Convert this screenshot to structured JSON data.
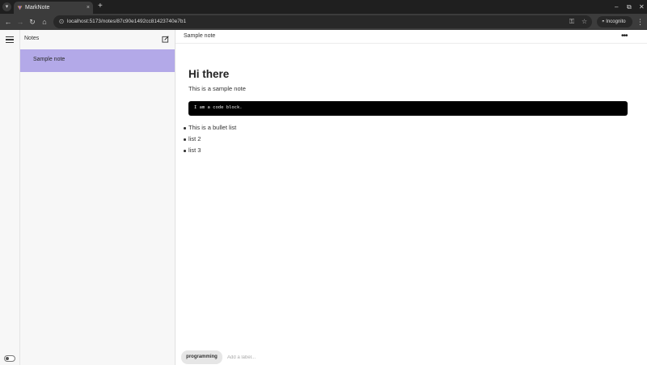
{
  "browser": {
    "tab_title": "MarkNote",
    "tab_close": "×",
    "new_tab": "+",
    "url": "localhost:5173/notes/87c90e1492cc81423740e7b1",
    "profile_label": "Incognito",
    "window_controls": [
      "–",
      "⧉",
      "✕"
    ]
  },
  "sidebar": {
    "title": "Notes",
    "notes": [
      {
        "title": "Sample note",
        "selected": true
      }
    ]
  },
  "editor": {
    "header_title": "Sample note",
    "menu_label": "•••",
    "heading": "Hi there",
    "paragraph": "This is a sample note",
    "code": "I am a code block.",
    "bullets": [
      "This is a bullet list",
      "list 2",
      "list 3"
    ]
  },
  "labels": {
    "chips": [
      "programming"
    ],
    "placeholder": "Add a label..."
  },
  "colors": {
    "selected_note": "#b3a9e8",
    "code_background": "#000000"
  }
}
